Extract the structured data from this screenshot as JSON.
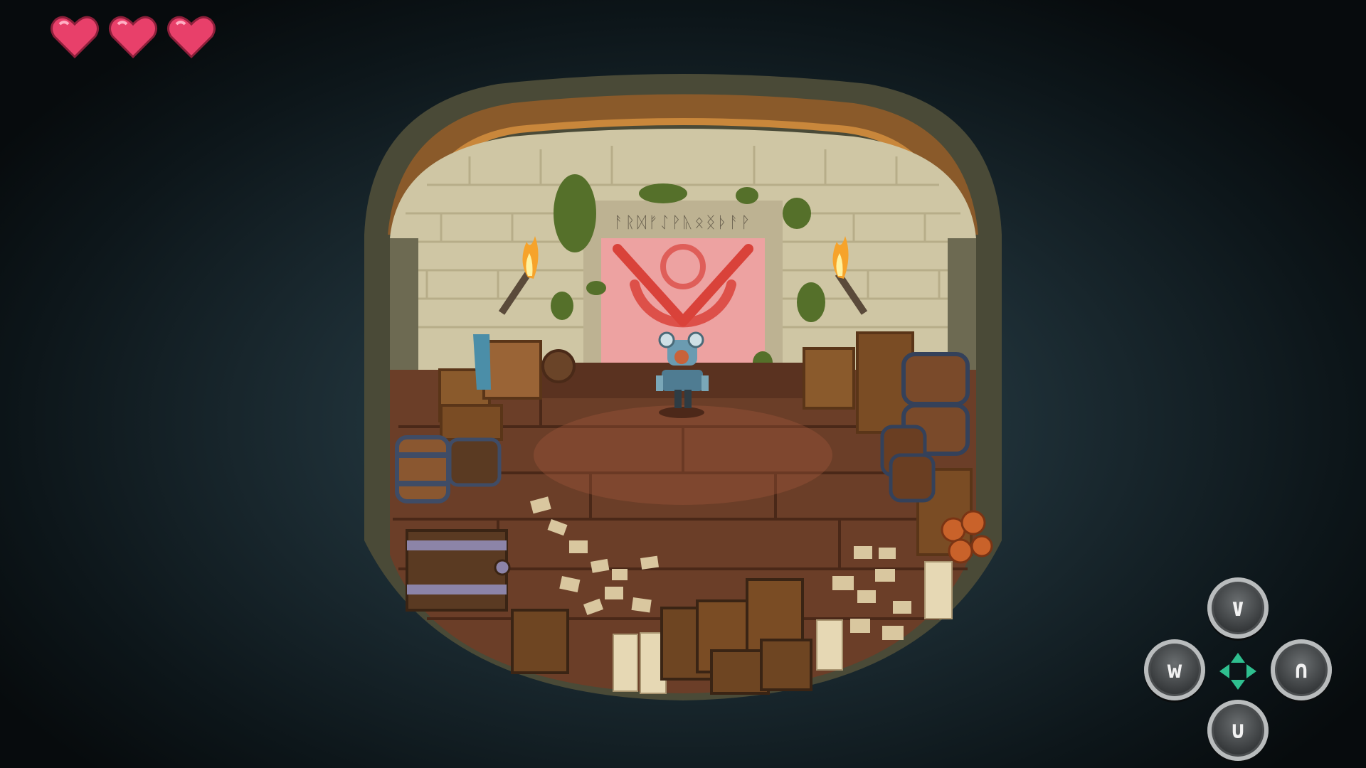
{
  "hud": {
    "hearts": {
      "current": 3,
      "max": 3,
      "color": "#e8406a"
    }
  },
  "controls": {
    "up_glyph": "∨",
    "left_glyph": "w",
    "right_glyph": "∩",
    "down_glyph": "∪",
    "center_arrows_color": "#2fbf8f",
    "button_icons": [
      "chevron-down-icon",
      "w-rune-icon",
      "arch-rune-icon",
      "cup-rune-icon"
    ]
  },
  "scene": {
    "door_runes": "ᚨᚱᛞᚠᛇᚹᚣᛟᛝᚦᚨᚹ",
    "door_symbol_color": "#d9423a",
    "torch_color": "#f6a32b"
  }
}
